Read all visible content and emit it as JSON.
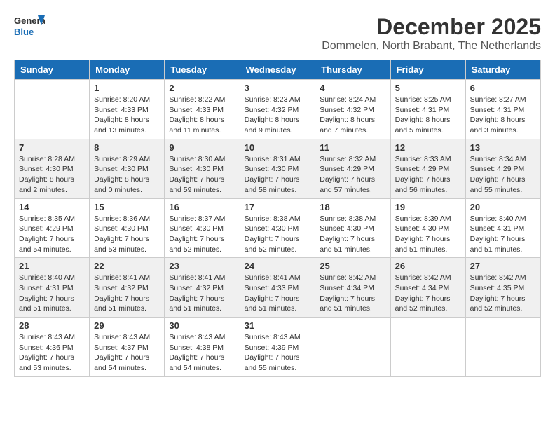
{
  "header": {
    "logo_general": "General",
    "logo_blue": "Blue",
    "month_title": "December 2025",
    "location": "Dommelen, North Brabant, The Netherlands"
  },
  "days_of_week": [
    "Sunday",
    "Monday",
    "Tuesday",
    "Wednesday",
    "Thursday",
    "Friday",
    "Saturday"
  ],
  "weeks": [
    [
      {
        "day": "",
        "info": ""
      },
      {
        "day": "1",
        "info": "Sunrise: 8:20 AM\nSunset: 4:33 PM\nDaylight: 8 hours\nand 13 minutes."
      },
      {
        "day": "2",
        "info": "Sunrise: 8:22 AM\nSunset: 4:33 PM\nDaylight: 8 hours\nand 11 minutes."
      },
      {
        "day": "3",
        "info": "Sunrise: 8:23 AM\nSunset: 4:32 PM\nDaylight: 8 hours\nand 9 minutes."
      },
      {
        "day": "4",
        "info": "Sunrise: 8:24 AM\nSunset: 4:32 PM\nDaylight: 8 hours\nand 7 minutes."
      },
      {
        "day": "5",
        "info": "Sunrise: 8:25 AM\nSunset: 4:31 PM\nDaylight: 8 hours\nand 5 minutes."
      },
      {
        "day": "6",
        "info": "Sunrise: 8:27 AM\nSunset: 4:31 PM\nDaylight: 8 hours\nand 3 minutes."
      }
    ],
    [
      {
        "day": "7",
        "info": "Sunrise: 8:28 AM\nSunset: 4:30 PM\nDaylight: 8 hours\nand 2 minutes."
      },
      {
        "day": "8",
        "info": "Sunrise: 8:29 AM\nSunset: 4:30 PM\nDaylight: 8 hours\nand 0 minutes."
      },
      {
        "day": "9",
        "info": "Sunrise: 8:30 AM\nSunset: 4:30 PM\nDaylight: 7 hours\nand 59 minutes."
      },
      {
        "day": "10",
        "info": "Sunrise: 8:31 AM\nSunset: 4:30 PM\nDaylight: 7 hours\nand 58 minutes."
      },
      {
        "day": "11",
        "info": "Sunrise: 8:32 AM\nSunset: 4:29 PM\nDaylight: 7 hours\nand 57 minutes."
      },
      {
        "day": "12",
        "info": "Sunrise: 8:33 AM\nSunset: 4:29 PM\nDaylight: 7 hours\nand 56 minutes."
      },
      {
        "day": "13",
        "info": "Sunrise: 8:34 AM\nSunset: 4:29 PM\nDaylight: 7 hours\nand 55 minutes."
      }
    ],
    [
      {
        "day": "14",
        "info": "Sunrise: 8:35 AM\nSunset: 4:29 PM\nDaylight: 7 hours\nand 54 minutes."
      },
      {
        "day": "15",
        "info": "Sunrise: 8:36 AM\nSunset: 4:30 PM\nDaylight: 7 hours\nand 53 minutes."
      },
      {
        "day": "16",
        "info": "Sunrise: 8:37 AM\nSunset: 4:30 PM\nDaylight: 7 hours\nand 52 minutes."
      },
      {
        "day": "17",
        "info": "Sunrise: 8:38 AM\nSunset: 4:30 PM\nDaylight: 7 hours\nand 52 minutes."
      },
      {
        "day": "18",
        "info": "Sunrise: 8:38 AM\nSunset: 4:30 PM\nDaylight: 7 hours\nand 51 minutes."
      },
      {
        "day": "19",
        "info": "Sunrise: 8:39 AM\nSunset: 4:30 PM\nDaylight: 7 hours\nand 51 minutes."
      },
      {
        "day": "20",
        "info": "Sunrise: 8:40 AM\nSunset: 4:31 PM\nDaylight: 7 hours\nand 51 minutes."
      }
    ],
    [
      {
        "day": "21",
        "info": "Sunrise: 8:40 AM\nSunset: 4:31 PM\nDaylight: 7 hours\nand 51 minutes."
      },
      {
        "day": "22",
        "info": "Sunrise: 8:41 AM\nSunset: 4:32 PM\nDaylight: 7 hours\nand 51 minutes."
      },
      {
        "day": "23",
        "info": "Sunrise: 8:41 AM\nSunset: 4:32 PM\nDaylight: 7 hours\nand 51 minutes."
      },
      {
        "day": "24",
        "info": "Sunrise: 8:41 AM\nSunset: 4:33 PM\nDaylight: 7 hours\nand 51 minutes."
      },
      {
        "day": "25",
        "info": "Sunrise: 8:42 AM\nSunset: 4:34 PM\nDaylight: 7 hours\nand 51 minutes."
      },
      {
        "day": "26",
        "info": "Sunrise: 8:42 AM\nSunset: 4:34 PM\nDaylight: 7 hours\nand 52 minutes."
      },
      {
        "day": "27",
        "info": "Sunrise: 8:42 AM\nSunset: 4:35 PM\nDaylight: 7 hours\nand 52 minutes."
      }
    ],
    [
      {
        "day": "28",
        "info": "Sunrise: 8:43 AM\nSunset: 4:36 PM\nDaylight: 7 hours\nand 53 minutes."
      },
      {
        "day": "29",
        "info": "Sunrise: 8:43 AM\nSunset: 4:37 PM\nDaylight: 7 hours\nand 54 minutes."
      },
      {
        "day": "30",
        "info": "Sunrise: 8:43 AM\nSunset: 4:38 PM\nDaylight: 7 hours\nand 54 minutes."
      },
      {
        "day": "31",
        "info": "Sunrise: 8:43 AM\nSunset: 4:39 PM\nDaylight: 7 hours\nand 55 minutes."
      },
      {
        "day": "",
        "info": ""
      },
      {
        "day": "",
        "info": ""
      },
      {
        "day": "",
        "info": ""
      }
    ]
  ]
}
